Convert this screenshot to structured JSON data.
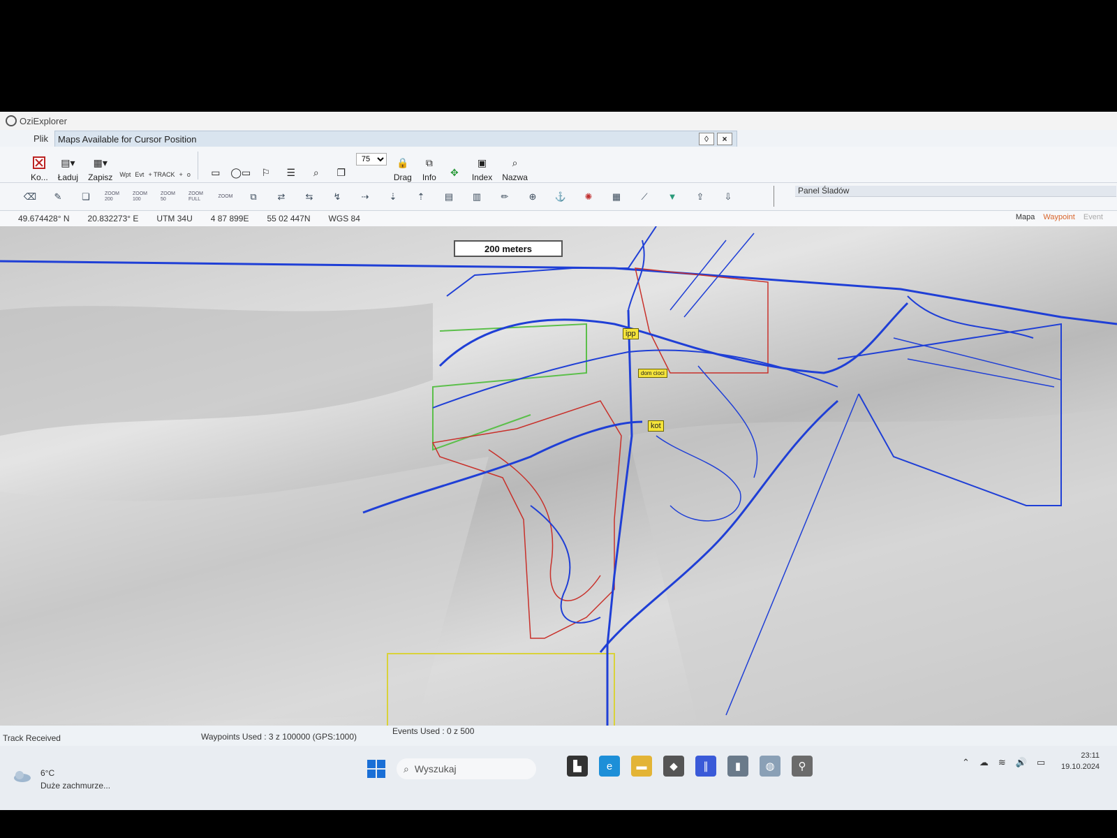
{
  "window": {
    "title": "OziExplorer"
  },
  "menu": {
    "file": "Plik"
  },
  "maps_bar": {
    "title": "Maps Available for Cursor Position",
    "pin": "◊",
    "close": "×"
  },
  "toolbar1": {
    "buttons": [
      {
        "label": "Ko...",
        "icon": "close-map-icon"
      },
      {
        "label": "Ładuj",
        "icon": "load-icon"
      },
      {
        "label": "Zapisz",
        "icon": "save-icon"
      }
    ],
    "small": [
      "Wpt",
      "Evt",
      "+ TRACK",
      "+",
      "o"
    ],
    "zoom_value": "75",
    "drag_label": "Drag",
    "info_label": "Info",
    "index_label": "Index",
    "nazwa_label": "Nazwa"
  },
  "toolbar2": {
    "zoom_buttons": [
      "ZOOM 200",
      "ZOOM 100",
      "ZOOM 50",
      "ZOOM FULL",
      "ZOOM"
    ]
  },
  "panel_sladow": {
    "title": "Panel Śladów"
  },
  "coords": {
    "lat": "49.674428° N",
    "lon": "20.832273° E",
    "zone": "UTM  34U",
    "easting": "4 87 899E",
    "northing": "55 02 447N",
    "datum": "WGS 84"
  },
  "layer_tabs": {
    "mapa": "Mapa",
    "waypoint": "Waypoint",
    "event": "Event"
  },
  "map": {
    "scale_label": "200 meters",
    "waypoints": [
      {
        "name": "ipp"
      },
      {
        "name": "dom cioci"
      },
      {
        "name": "kot"
      }
    ],
    "colors": {
      "track_blue": "#1f3fd6",
      "track_red": "#c8302a",
      "outline_yellow": "#d9d23a",
      "outline_green": "#5bbf4a"
    }
  },
  "status": {
    "track_received": "Track Received",
    "waypoints_used": "Waypoints Used : 3 z 100000  (GPS:1000)",
    "events_used": "Events Used : 0 z 500"
  },
  "taskbar": {
    "weather_temp": "6°C",
    "weather_desc": "Duże zachmurze...",
    "search_placeholder": "Wyszukaj",
    "time": "23:11",
    "date": "19.10.2024"
  }
}
